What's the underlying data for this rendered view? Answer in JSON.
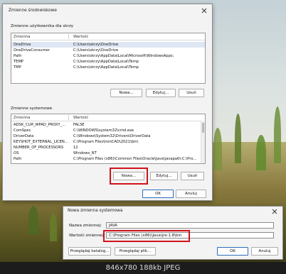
{
  "env_dialog": {
    "title": "Zmienne środowiskowe",
    "user_group": "Zmienne użytkownika dla skrzy",
    "columns": {
      "name": "Zmienna",
      "value": "Wartość"
    },
    "user_vars": [
      {
        "name": "OneDrive",
        "value": "C:\\Users\\skrzy\\OneDrive"
      },
      {
        "name": "OneDriveConsumer",
        "value": "C:\\Users\\skrzy\\OneDrive"
      },
      {
        "name": "Path",
        "value": "C:\\Users\\skrzy\\AppData\\Local\\Microsoft\\WindowsApps;"
      },
      {
        "name": "TEMP",
        "value": "C:\\Users\\skrzy\\AppData\\Local\\Temp"
      },
      {
        "name": "TMP",
        "value": "C:\\Users\\skrzy\\AppData\\Local\\Temp"
      }
    ],
    "user_buttons": {
      "new": "Nowa...",
      "edit": "Edytuj...",
      "delete": "Usuń"
    },
    "system_group": "Zmienne systemowe",
    "system_vars": [
      {
        "name": "ADSK_CLM_WPAD_PROXY_...",
        "value": "FALSE"
      },
      {
        "name": "ComSpec",
        "value": "C:\\WINDOWS\\system32\\cmd.exe"
      },
      {
        "name": "DriverData",
        "value": "C:\\Windows\\System32\\Drivers\\DriverData"
      },
      {
        "name": "KEYSHOT_EXTERNAL_LICEN...",
        "value": "C:\\Program Files\\IronCAD\\2021\\bin\\"
      },
      {
        "name": "NUMBER_OF_PROCESSORS",
        "value": "12"
      },
      {
        "name": "OS",
        "value": "Windows_NT"
      },
      {
        "name": "Path",
        "value": "C:\\Program Files (x86)\\Common Files\\Oracle\\Java\\javapath;C:\\Pro..."
      }
    ],
    "system_buttons": {
      "new": "Nowa...",
      "edit": "Edytuj...",
      "delete": "Usuń"
    },
    "ok": "OK",
    "cancel": "Anuluj"
  },
  "new_var_dialog": {
    "title": "Nowa zmienna systemowa",
    "name_label": "Nazwa zmiennej:",
    "name_value": "JAVA",
    "value_label": "Wartość zmiennej:",
    "value_value": "C:\\Program Files (x86)\\Java\\jre-1.8\\bin",
    "browse_dir": "Przeglądaj katalog...",
    "browse_file": "Przeglądaj plik...",
    "ok": "OK",
    "cancel": "Anuluj"
  },
  "footer": "846x780  188kb  JPEG",
  "colors": {
    "highlight": "#d1121b",
    "selection": "#dfe6f3"
  }
}
